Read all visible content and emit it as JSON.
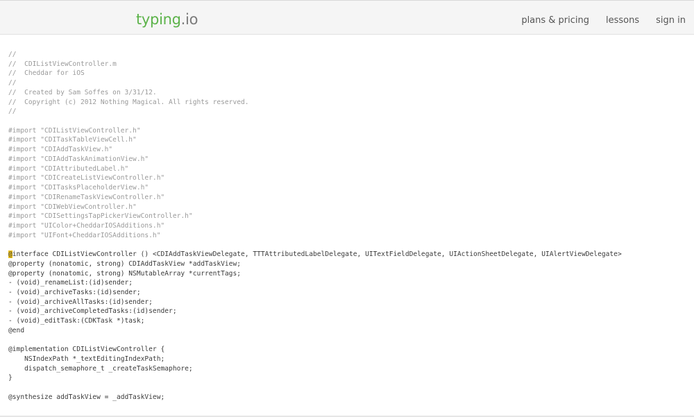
{
  "header": {
    "logo_main": "typing",
    "logo_tld": ".io",
    "nav": [
      "plans & pricing",
      "lessons",
      "sign in"
    ],
    "colors": {
      "logo_main": "#5cb34a",
      "logo_tld": "#7a7a7a",
      "bar": "#f5f5f5"
    }
  },
  "editor": {
    "typed_lines": [
      "//",
      "//  CDIListViewController.m",
      "//  Cheddar for iOS",
      "//",
      "//  Created by Sam Soffes on 3/31/12.",
      "//  Copyright (c) 2012 Nothing Magical. All rights reserved.",
      "//",
      "",
      "#import \"CDIListViewController.h\"",
      "#import \"CDITaskTableViewCell.h\"",
      "#import \"CDIAddTaskView.h\"",
      "#import \"CDIAddTaskAnimationView.h\"",
      "#import \"CDIAttributedLabel.h\"",
      "#import \"CDICreateListViewController.h\"",
      "#import \"CDITasksPlaceholderView.h\"",
      "#import \"CDIRenameTaskViewController.h\"",
      "#import \"CDIWebViewController.h\"",
      "#import \"CDISettingsTapPickerViewController.h\"",
      "#import \"UIColor+CheddarIOSAdditions.h\"",
      "#import \"UIFont+CheddarIOSAdditions.h\"",
      ""
    ],
    "cursor_char": "@",
    "current_line_rest": "interface CDIListViewController () <CDIAddTaskViewDelegate, TTTAttributedLabelDelegate, UITextFieldDelegate, UIActionSheetDelegate, UIAlertViewDelegate>",
    "pending_lines": [
      "@property (nonatomic, strong) CDIAddTaskView *addTaskView;",
      "@property (nonatomic, strong) NSMutableArray *currentTags;",
      "- (void)_renameList:(id)sender;",
      "- (void)_archiveTasks:(id)sender;",
      "- (void)_archiveAllTasks:(id)sender;",
      "- (void)_archiveCompletedTasks:(id)sender;",
      "- (void)_editTask:(CDKTask *)task;",
      "@end",
      "",
      "@implementation CDIListViewController {",
      "    NSIndexPath *_textEditingIndexPath;",
      "    dispatch_semaphore_t _createTaskSemaphore;",
      "}",
      "",
      "@synthesize addTaskView = _addTaskView;"
    ],
    "colors": {
      "typed": "#9a9a9a",
      "pending": "#3a3a3a",
      "cursor": "#f0c419"
    }
  }
}
